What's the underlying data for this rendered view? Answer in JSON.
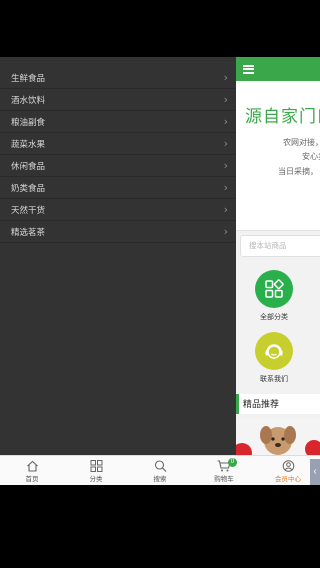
{
  "drawer": {
    "items": [
      {
        "label": "生鲜食品"
      },
      {
        "label": "酒水饮料"
      },
      {
        "label": "粮油副食"
      },
      {
        "label": "蔬菜水果"
      },
      {
        "label": "休闲食品"
      },
      {
        "label": "奶类食品"
      },
      {
        "label": "天然干货"
      },
      {
        "label": "精选茗茶"
      }
    ]
  },
  "main": {
    "hero_title": "源自家门口",
    "hero_line1": "农网对接，",
    "hero_line2": "安心卖",
    "hero_line3": "当日采摘，",
    "search_placeholder": "搜本站商品",
    "categories": [
      {
        "label": "全部分类",
        "icon": "grid-icon"
      },
      {
        "label": "联系我们",
        "icon": "headset-icon"
      }
    ],
    "recommend_title": "精品推荐"
  },
  "tabbar": {
    "tabs": [
      {
        "label": "首页",
        "icon": "home-icon"
      },
      {
        "label": "分类",
        "icon": "category-icon"
      },
      {
        "label": "搜索",
        "icon": "search-icon"
      },
      {
        "label": "购物车",
        "icon": "cart-icon",
        "badge": "0"
      },
      {
        "label": "会员中心",
        "icon": "user-icon"
      }
    ]
  },
  "colors": {
    "brand_green": "#3aa84a",
    "drawer_bg": "#333333",
    "contact_yellow": "#c7cf2f",
    "member_orange": "#e57a1e"
  }
}
